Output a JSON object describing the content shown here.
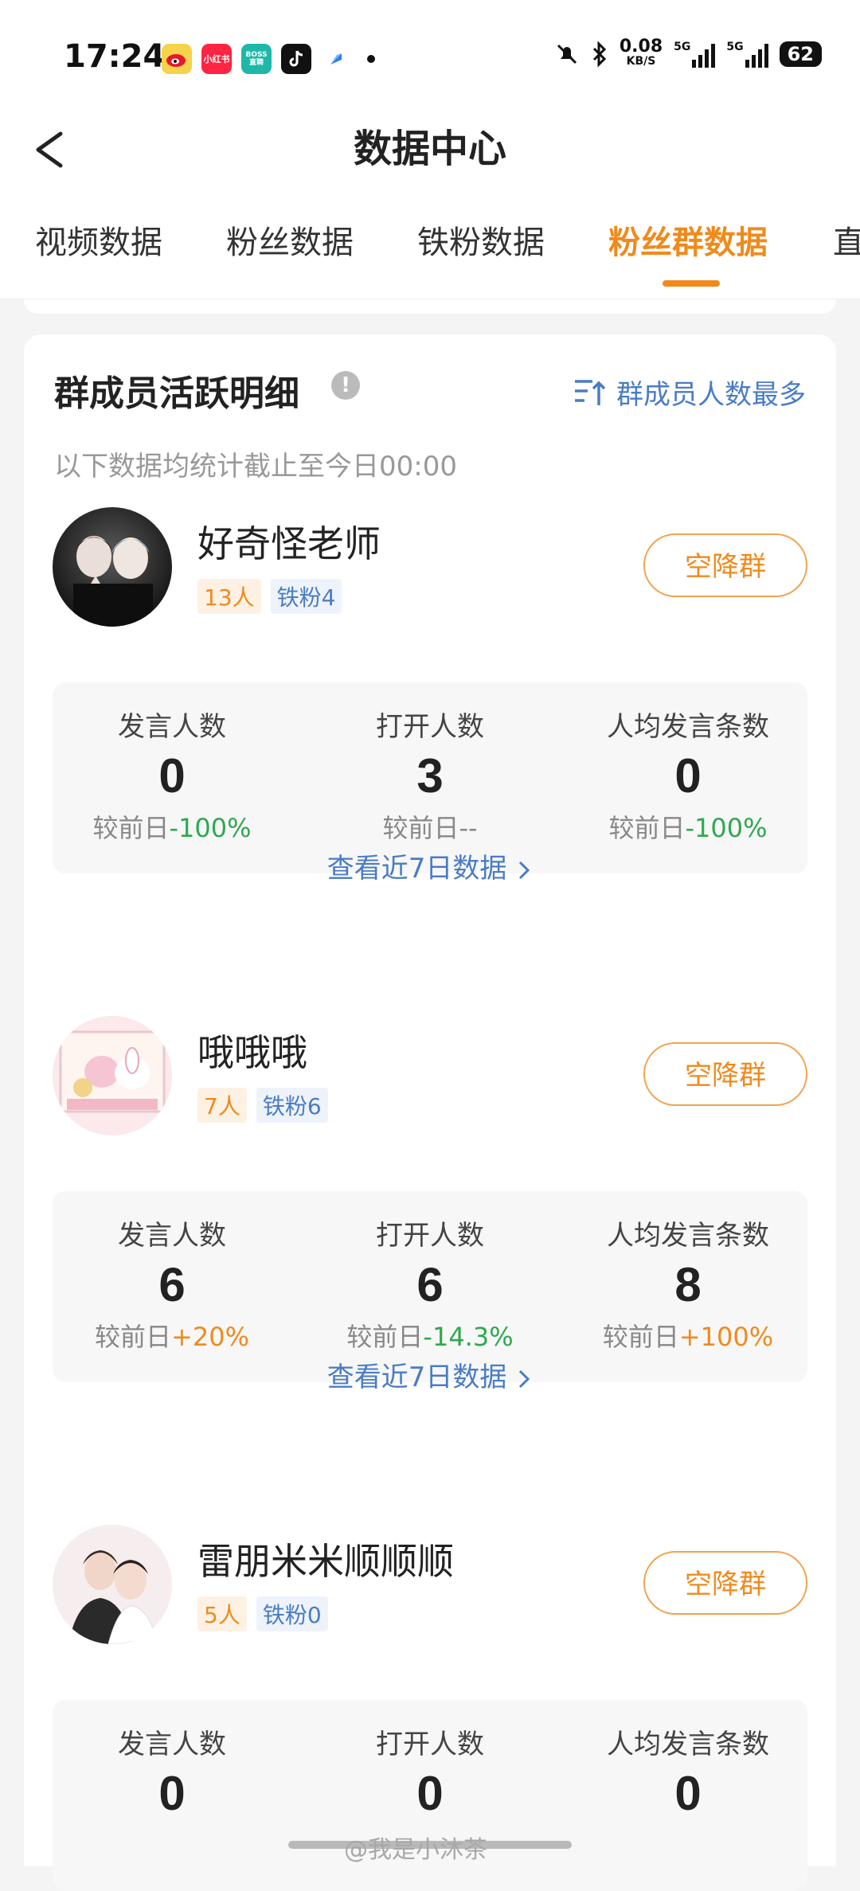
{
  "status_bar": {
    "time": "17:24",
    "net_speed": "0.08",
    "net_unit": "KB/S",
    "sig1": "5G",
    "sig2": "5G",
    "battery": "62",
    "app_icons": [
      "weibo-icon",
      "xiaohongshu-icon",
      "boss-zhipin-icon",
      "tiktok-icon",
      "blue-app-icon"
    ],
    "app_labels": {
      "xhs": "小红书",
      "boss": "BOSS\n直聘"
    }
  },
  "header": {
    "title": "数据中心",
    "tabs": [
      "视频数据",
      "粉丝数据",
      "铁粉数据",
      "粉丝群数据",
      "直"
    ],
    "active_tab_index": 3
  },
  "section": {
    "title": "群成员活跃明细",
    "sort_label": "群成员人数最多",
    "subtitle": "以下数据均统计截止至今日00:00"
  },
  "groups": [
    {
      "name": "好奇怪老师",
      "members": "13人",
      "iron_fans": "铁粉4",
      "button": "空降群",
      "stats": [
        {
          "label": "发言人数",
          "value": "0",
          "cmp_prefix": "较前日",
          "cmp": "-100%",
          "trend": "down"
        },
        {
          "label": "打开人数",
          "value": "3",
          "cmp_prefix": "较前日",
          "cmp": "--",
          "trend": "neutral"
        },
        {
          "label": "人均发言条数",
          "value": "0",
          "cmp_prefix": "较前日",
          "cmp": "-100%",
          "trend": "down"
        }
      ],
      "more": "查看近7日数据"
    },
    {
      "name": "哦哦哦",
      "members": "7人",
      "iron_fans": "铁粉6",
      "button": "空降群",
      "stats": [
        {
          "label": "发言人数",
          "value": "6",
          "cmp_prefix": "较前日",
          "cmp": "+20%",
          "trend": "up"
        },
        {
          "label": "打开人数",
          "value": "6",
          "cmp_prefix": "较前日",
          "cmp": "-14.3%",
          "trend": "down"
        },
        {
          "label": "人均发言条数",
          "value": "8",
          "cmp_prefix": "较前日",
          "cmp": "+100%",
          "trend": "up"
        }
      ],
      "more": "查看近7日数据"
    },
    {
      "name": "雷朋米米顺顺顺",
      "members": "5人",
      "iron_fans": "铁粉0",
      "button": "空降群",
      "stats": [
        {
          "label": "发言人数",
          "value": "0"
        },
        {
          "label": "打开人数",
          "value": "0"
        },
        {
          "label": "人均发言条数",
          "value": "0"
        }
      ]
    }
  ],
  "watermark": "@我是小沐茶",
  "colors": {
    "accent": "#f08a1c",
    "link": "#4a7cc4",
    "down": "#2fa84f"
  }
}
